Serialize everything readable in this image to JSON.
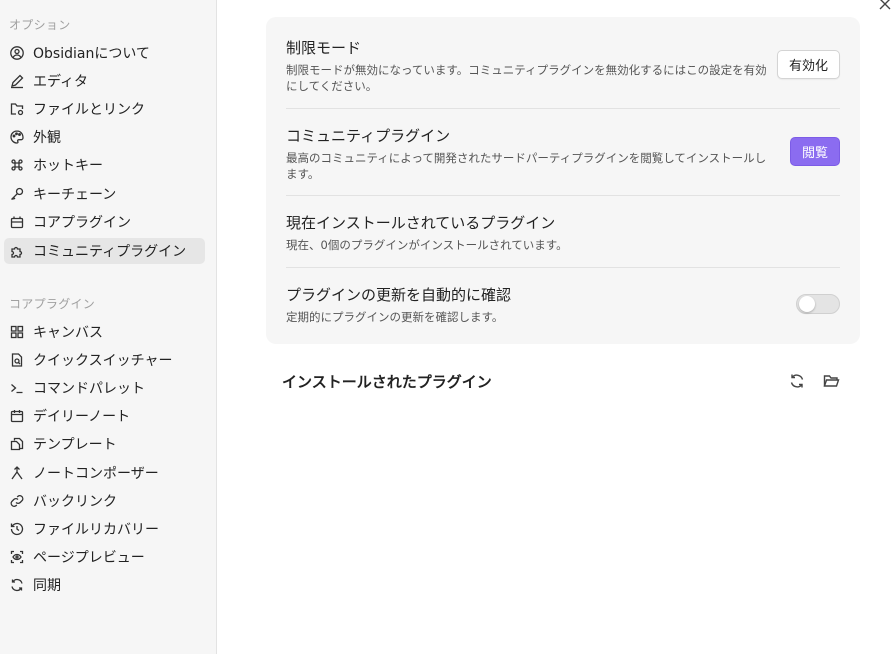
{
  "sidebar": {
    "options_title": "オプション",
    "options_items": [
      {
        "label": "Obsidianについて",
        "icon": "info-circle-icon"
      },
      {
        "label": "エディタ",
        "icon": "pencil-icon"
      },
      {
        "label": "ファイルとリンク",
        "icon": "folder-cog-icon"
      },
      {
        "label": "外観",
        "icon": "palette-icon"
      },
      {
        "label": "ホットキー",
        "icon": "command-icon"
      },
      {
        "label": "キーチェーン",
        "icon": "key-icon"
      },
      {
        "label": "コアプラグイン",
        "icon": "plug-icon"
      },
      {
        "label": "コミュニティプラグイン",
        "icon": "puzzle-icon",
        "active": true
      }
    ],
    "core_title": "コアプラグイン",
    "core_items": [
      {
        "label": "キャンバス",
        "icon": "layout-icon"
      },
      {
        "label": "クイックスイッチャー",
        "icon": "file-search-icon"
      },
      {
        "label": "コマンドパレット",
        "icon": "terminal-icon"
      },
      {
        "label": "デイリーノート",
        "icon": "calendar-icon"
      },
      {
        "label": "テンプレート",
        "icon": "files-icon"
      },
      {
        "label": "ノートコンポーザー",
        "icon": "merge-icon"
      },
      {
        "label": "バックリンク",
        "icon": "link-icon"
      },
      {
        "label": "ファイルリカバリー",
        "icon": "history-icon"
      },
      {
        "label": "ページプレビュー",
        "icon": "scan-eye-icon"
      },
      {
        "label": "同期",
        "icon": "sync-icon"
      }
    ]
  },
  "settings": {
    "restricted": {
      "name": "制限モード",
      "desc": "制限モードが無効になっています。コミュニティプラグインを無効化するにはこの設定を有効にしてください。",
      "button": "有効化"
    },
    "community": {
      "name": "コミュニティプラグイン",
      "desc": "最高のコミュニティによって開発されたサードパーティプラグインを閲覧してインストールします。",
      "button": "閲覧"
    },
    "installed": {
      "name": "現在インストールされているプラグイン",
      "desc": "現在、0個のプラグインがインストールされています。"
    },
    "updates": {
      "name": "プラグインの更新を自動的に確認",
      "desc": "定期的にプラグインの更新を確認します。",
      "enabled": false
    }
  },
  "installed_section": {
    "title": "インストールされたプラグイン",
    "icons": [
      "reload-icon",
      "folder-open-icon"
    ]
  },
  "colors": {
    "accent": "#8b6cf0",
    "sidebar_bg": "#f6f6f6",
    "card_bg": "#f6f6f6"
  }
}
